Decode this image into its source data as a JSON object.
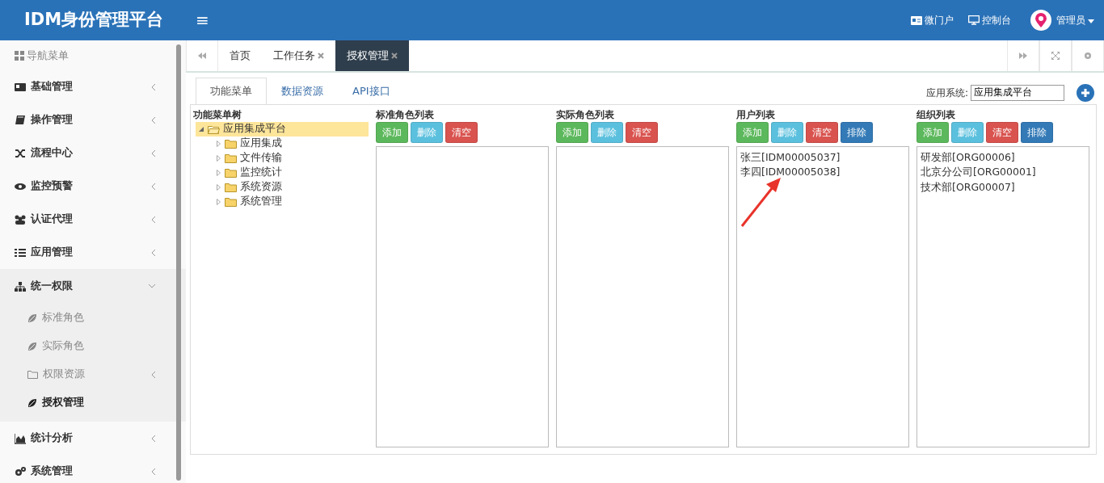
{
  "header": {
    "logo": "IDM身份管理平台",
    "menu_toggle": "≡",
    "links": [
      {
        "label": "微门户",
        "kind": "card"
      },
      {
        "label": "控制台",
        "kind": "monitor"
      }
    ],
    "user": {
      "name": "管理员"
    }
  },
  "sidebar": {
    "title": "导航菜单",
    "items": [
      {
        "label": "基础管理",
        "expanded": false
      },
      {
        "label": "操作管理",
        "expanded": false
      },
      {
        "label": "流程中心",
        "expanded": false
      },
      {
        "label": "监控预警",
        "expanded": false
      },
      {
        "label": "认证代理",
        "expanded": false
      },
      {
        "label": "应用管理",
        "expanded": false
      },
      {
        "label": "统一权限",
        "expanded": true,
        "children": [
          {
            "label": "标准角色",
            "kind": "leaf",
            "selected": false
          },
          {
            "label": "实际角色",
            "kind": "leaf",
            "selected": false
          },
          {
            "label": "权限资源",
            "kind": "folder",
            "selected": false
          },
          {
            "label": "授权管理",
            "kind": "leaf",
            "selected": true
          }
        ]
      },
      {
        "label": "统计分析",
        "expanded": false
      },
      {
        "label": "系统管理",
        "expanded": false
      }
    ]
  },
  "tabs": [
    {
      "label": "首页",
      "closable": false,
      "selected": false
    },
    {
      "label": "工作任务",
      "closable": true,
      "selected": false
    },
    {
      "label": "授权管理",
      "closable": true,
      "selected": true
    }
  ],
  "sub_tabs": [
    {
      "label": "功能菜单",
      "selected": true
    },
    {
      "label": "数据资源",
      "selected": false
    },
    {
      "label": "API接口",
      "selected": false
    }
  ],
  "app_system": {
    "label": "应用系统:",
    "value": "应用集成平台"
  },
  "tree": {
    "title": "功能菜单树",
    "root": {
      "label": "应用集成平台",
      "expanded": true,
      "selected": true,
      "children": [
        {
          "label": "应用集成",
          "expanded": false,
          "selected": false
        },
        {
          "label": "文件传输",
          "expanded": false,
          "selected": false
        },
        {
          "label": "监控统计",
          "expanded": false,
          "selected": false
        },
        {
          "label": "系统资源",
          "expanded": false,
          "selected": false
        },
        {
          "label": "系统管理",
          "expanded": false,
          "selected": false
        }
      ]
    }
  },
  "lists": [
    {
      "title": "标准角色列表",
      "buttons": [
        {
          "label": "添加",
          "kind": "add"
        },
        {
          "label": "删除",
          "kind": "delete"
        },
        {
          "label": "清空",
          "kind": "clear"
        }
      ]
    },
    {
      "title": "实际角色列表",
      "buttons": [
        {
          "label": "添加",
          "kind": "add"
        },
        {
          "label": "删除",
          "kind": "delete"
        },
        {
          "label": "清空",
          "kind": "clear"
        }
      ]
    },
    {
      "title": "用户列表",
      "buttons": [
        {
          "label": "添加",
          "kind": "add"
        },
        {
          "label": "删除",
          "kind": "delete"
        },
        {
          "label": "清空",
          "kind": "clear"
        },
        {
          "label": "排除",
          "kind": "exclude"
        }
      ],
      "items": [
        "张三[IDM00005037]",
        "李四[IDM00005038]"
      ]
    },
    {
      "title": "组织列表",
      "buttons": [
        {
          "label": "添加",
          "kind": "add"
        },
        {
          "label": "删除",
          "kind": "delete"
        },
        {
          "label": "清空",
          "kind": "clear"
        },
        {
          "label": "排除",
          "kind": "exclude"
        }
      ],
      "items": [
        "研发部[ORG00006]",
        "北京分公司[ORG00001]",
        "技术部[ORG00007]"
      ]
    }
  ]
}
